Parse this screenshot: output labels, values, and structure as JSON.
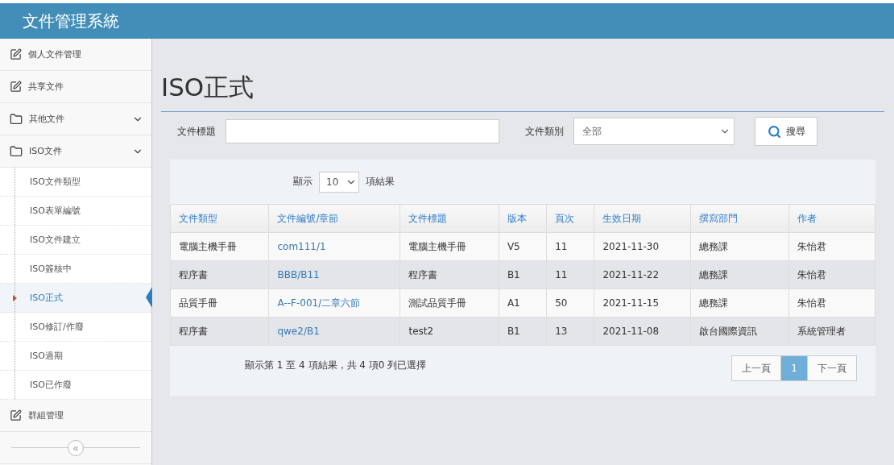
{
  "app": {
    "title": "文件管理系統"
  },
  "sidebar": {
    "items": [
      {
        "label": "個人文件管理",
        "kind": "edit"
      },
      {
        "label": "共享文件",
        "kind": "edit"
      },
      {
        "label": "其他文件",
        "kind": "folder"
      },
      {
        "label": "ISO文件",
        "kind": "folder",
        "children": [
          {
            "label": "ISO文件類型",
            "selected": false
          },
          {
            "label": "ISO表單編號",
            "selected": false
          },
          {
            "label": "ISO文件建立",
            "selected": false
          },
          {
            "label": "ISO簽核中",
            "selected": false
          },
          {
            "label": "ISO正式",
            "selected": true
          },
          {
            "label": "ISO修訂/作廢",
            "selected": false
          },
          {
            "label": "ISO過期",
            "selected": false
          },
          {
            "label": "ISO已作廢",
            "selected": false
          }
        ]
      },
      {
        "label": "群組管理",
        "kind": "edit"
      }
    ],
    "collapse_button": "«"
  },
  "page": {
    "title": "ISO正式"
  },
  "filters": {
    "title_label": "文件標題",
    "type_label": "文件類別",
    "type_value": "全部",
    "search_button": "搜尋"
  },
  "table": {
    "length_prefix": "顯示",
    "length_value": "10",
    "length_suffix": "項結果",
    "columns": [
      "文件類型",
      "文件編號/章節",
      "文件標題",
      "版本",
      "頁次",
      "生效日期",
      "撰寫部門",
      "作者"
    ],
    "rows": [
      [
        "電腦主機手冊",
        "com111/1",
        "電腦主機手冊",
        "V5",
        "11",
        "2021-11-30",
        "總務課",
        "朱怡君"
      ],
      [
        "程序書",
        "BBB/B11",
        "程序書",
        "B1",
        "11",
        "2021-11-22",
        "總務課",
        "朱怡君"
      ],
      [
        "品質手冊",
        "A--F-001/二章六節",
        "測試品質手冊",
        "A1",
        "50",
        "2021-11-15",
        "總務課",
        "朱怡君"
      ],
      [
        "程序書",
        "qwe2/B1",
        "test2",
        "B1",
        "13",
        "2021-11-08",
        "啟台國際資訊",
        "系統管理者"
      ]
    ],
    "info": "顯示第 1 至 4 項結果，共 4 項0 列已選擇",
    "pages": [
      {
        "label": "上一頁",
        "selected": false
      },
      {
        "label": "1",
        "selected": true
      },
      {
        "label": "下一頁",
        "selected": false
      }
    ]
  }
}
